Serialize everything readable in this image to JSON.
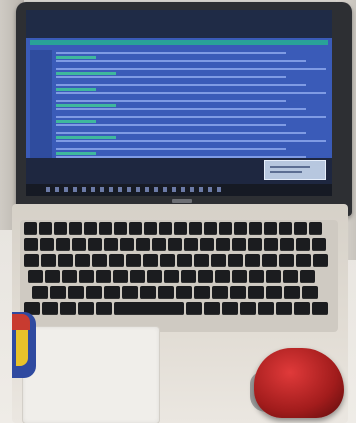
{
  "scene": {
    "description_free": true,
    "colors": {
      "screen": "#3a5bb8",
      "accent": "#29a398",
      "bezel": "#2d2f33",
      "mouse": "#c62828"
    },
    "icons": [
      "laptop-logo",
      "mouse",
      "sticker"
    ]
  }
}
